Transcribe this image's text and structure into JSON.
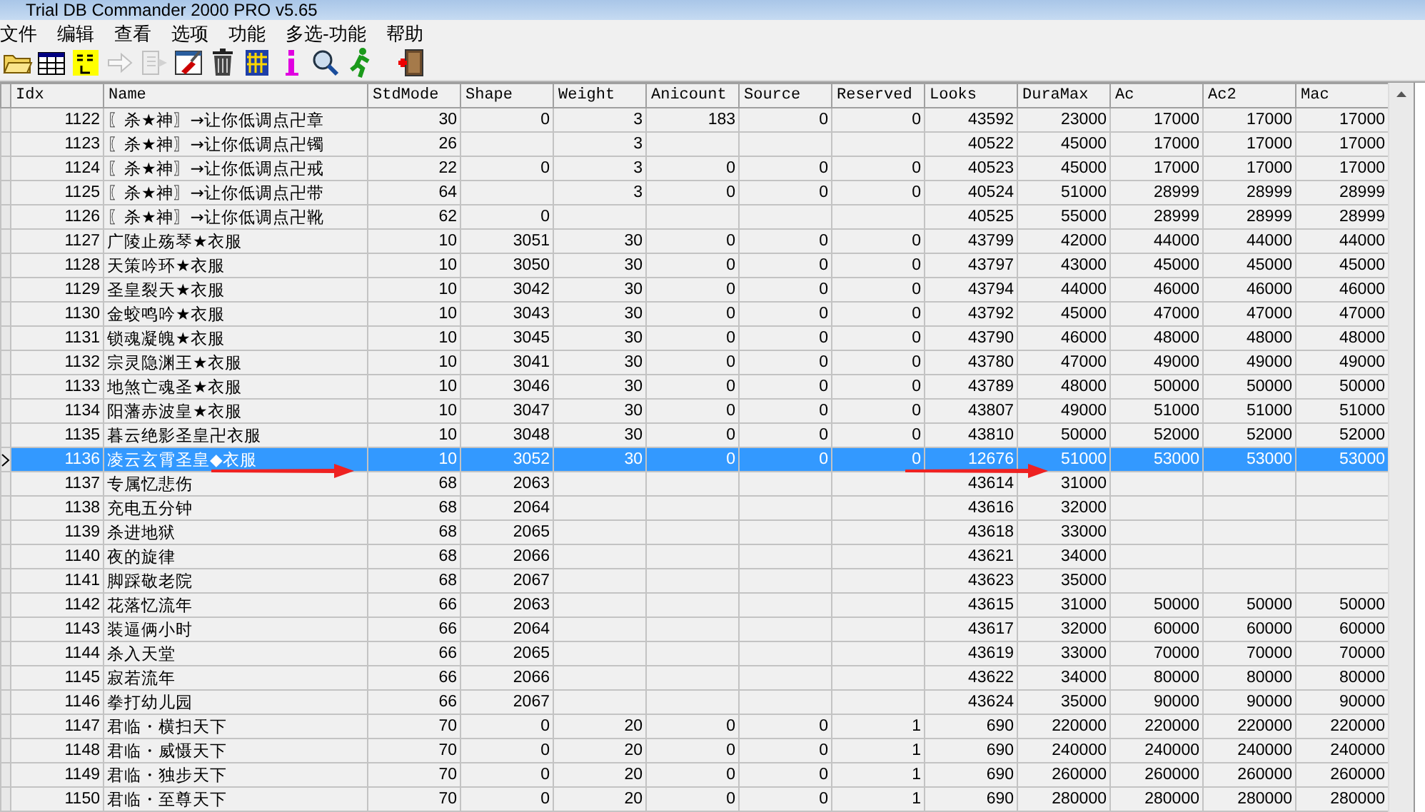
{
  "window": {
    "title": "Trial DB Commander 2000 PRO v5.65"
  },
  "menu": [
    "文件",
    "编辑",
    "查看",
    "选项",
    "功能",
    "多选-功能",
    "帮助"
  ],
  "toolbar": [
    {
      "kind": "folder",
      "disabled": false
    },
    {
      "kind": "table",
      "disabled": false
    },
    {
      "kind": "sql",
      "disabled": false
    },
    {
      "kind": "arrow",
      "disabled": true
    },
    {
      "kind": "doc-arrow",
      "disabled": true
    },
    {
      "kind": "brush",
      "disabled": false
    },
    {
      "kind": "trash",
      "disabled": false
    },
    {
      "kind": "grid",
      "disabled": false
    },
    {
      "kind": "info",
      "disabled": false
    },
    {
      "kind": "magnifier",
      "disabled": false
    },
    {
      "kind": "runner",
      "disabled": false
    },
    {
      "kind": "exit",
      "disabled": false
    }
  ],
  "table": {
    "columns": [
      "Idx",
      "Name",
      "StdMode",
      "Shape",
      "Weight",
      "Anicount",
      "Source",
      "Reserved",
      "Looks",
      "DuraMax",
      "Ac",
      "Ac2",
      "Mac"
    ],
    "rows": [
      {
        "selected": false,
        "cells": [
          "1122",
          "〖杀★神〗→让你低调点卍章",
          "30",
          "0",
          "3",
          "183",
          "0",
          "0",
          "43592",
          "23000",
          "17000",
          "17000",
          "17000"
        ]
      },
      {
        "selected": false,
        "cells": [
          "1123",
          "〖杀★神〗→让你低调点卍镯",
          "26",
          null,
          "3",
          null,
          null,
          null,
          "40522",
          "45000",
          "17000",
          "17000",
          "17000"
        ]
      },
      {
        "selected": false,
        "cells": [
          "1124",
          "〖杀★神〗→让你低调点卍戒",
          "22",
          "0",
          "3",
          "0",
          "0",
          "0",
          "40523",
          "45000",
          "17000",
          "17000",
          "17000"
        ]
      },
      {
        "selected": false,
        "cells": [
          "1125",
          "〖杀★神〗→让你低调点卍带",
          "64",
          null,
          "3",
          "0",
          "0",
          "0",
          "40524",
          "51000",
          "28999",
          "28999",
          "28999"
        ]
      },
      {
        "selected": false,
        "cells": [
          "1126",
          "〖杀★神〗→让你低调点卍靴",
          "62",
          "0",
          null,
          null,
          null,
          null,
          "40525",
          "55000",
          "28999",
          "28999",
          "28999"
        ]
      },
      {
        "selected": false,
        "cells": [
          "1127",
          "广陵止殇琴★衣服",
          "10",
          "3051",
          "30",
          "0",
          "0",
          "0",
          "43799",
          "42000",
          "44000",
          "44000",
          "44000"
        ]
      },
      {
        "selected": false,
        "cells": [
          "1128",
          "天策吟环★衣服",
          "10",
          "3050",
          "30",
          "0",
          "0",
          "0",
          "43797",
          "43000",
          "45000",
          "45000",
          "45000"
        ]
      },
      {
        "selected": false,
        "cells": [
          "1129",
          "圣皇裂天★衣服",
          "10",
          "3042",
          "30",
          "0",
          "0",
          "0",
          "43794",
          "44000",
          "46000",
          "46000",
          "46000"
        ]
      },
      {
        "selected": false,
        "cells": [
          "1130",
          "金蛟鸣吟★衣服",
          "10",
          "3043",
          "30",
          "0",
          "0",
          "0",
          "43792",
          "45000",
          "47000",
          "47000",
          "47000"
        ]
      },
      {
        "selected": false,
        "cells": [
          "1131",
          "锁魂凝魄★衣服",
          "10",
          "3045",
          "30",
          "0",
          "0",
          "0",
          "43790",
          "46000",
          "48000",
          "48000",
          "48000"
        ]
      },
      {
        "selected": false,
        "cells": [
          "1132",
          "宗灵隐渊王★衣服",
          "10",
          "3041",
          "30",
          "0",
          "0",
          "0",
          "43780",
          "47000",
          "49000",
          "49000",
          "49000"
        ]
      },
      {
        "selected": false,
        "cells": [
          "1133",
          "地煞亡魂圣★衣服",
          "10",
          "3046",
          "30",
          "0",
          "0",
          "0",
          "43789",
          "48000",
          "50000",
          "50000",
          "50000"
        ]
      },
      {
        "selected": false,
        "cells": [
          "1134",
          "阳藩赤波皇★衣服",
          "10",
          "3047",
          "30",
          "0",
          "0",
          "0",
          "43807",
          "49000",
          "51000",
          "51000",
          "51000"
        ]
      },
      {
        "selected": false,
        "cells": [
          "1135",
          "暮云绝影圣皇卍衣服",
          "10",
          "3048",
          "30",
          "0",
          "0",
          "0",
          "43810",
          "50000",
          "52000",
          "52000",
          "52000"
        ]
      },
      {
        "selected": true,
        "cells": [
          "1136",
          "凌云玄霄圣皇◆衣服",
          "10",
          "3052",
          "30",
          "0",
          "0",
          "0",
          "12676",
          "51000",
          "53000",
          "53000",
          "53000"
        ]
      },
      {
        "selected": false,
        "cells": [
          "1137",
          "专属忆悲伤",
          "68",
          "2063",
          null,
          null,
          null,
          null,
          "43614",
          "31000",
          null,
          null,
          null
        ]
      },
      {
        "selected": false,
        "cells": [
          "1138",
          "充电五分钟",
          "68",
          "2064",
          null,
          null,
          null,
          null,
          "43616",
          "32000",
          null,
          null,
          null
        ]
      },
      {
        "selected": false,
        "cells": [
          "1139",
          "杀进地狱",
          "68",
          "2065",
          null,
          null,
          null,
          null,
          "43618",
          "33000",
          null,
          null,
          null
        ]
      },
      {
        "selected": false,
        "cells": [
          "1140",
          "夜的旋律",
          "68",
          "2066",
          null,
          null,
          null,
          null,
          "43621",
          "34000",
          null,
          null,
          null
        ]
      },
      {
        "selected": false,
        "cells": [
          "1141",
          "脚踩敬老院",
          "68",
          "2067",
          null,
          null,
          null,
          null,
          "43623",
          "35000",
          null,
          null,
          null
        ]
      },
      {
        "selected": false,
        "cells": [
          "1142",
          "花落忆流年",
          "66",
          "2063",
          null,
          null,
          null,
          null,
          "43615",
          "31000",
          "50000",
          "50000",
          "50000"
        ]
      },
      {
        "selected": false,
        "cells": [
          "1143",
          "装逼俩小时",
          "66",
          "2064",
          null,
          null,
          null,
          null,
          "43617",
          "32000",
          "60000",
          "60000",
          "60000"
        ]
      },
      {
        "selected": false,
        "cells": [
          "1144",
          "杀入天堂",
          "66",
          "2065",
          null,
          null,
          null,
          null,
          "43619",
          "33000",
          "70000",
          "70000",
          "70000"
        ]
      },
      {
        "selected": false,
        "cells": [
          "1145",
          "寂若流年",
          "66",
          "2066",
          null,
          null,
          null,
          null,
          "43622",
          "34000",
          "80000",
          "80000",
          "80000"
        ]
      },
      {
        "selected": false,
        "cells": [
          "1146",
          "拳打幼儿园",
          "66",
          "2067",
          null,
          null,
          null,
          null,
          "43624",
          "35000",
          "90000",
          "90000",
          "90000"
        ]
      },
      {
        "selected": false,
        "cells": [
          "1147",
          "君临・横扫天下",
          "70",
          "0",
          "20",
          "0",
          "0",
          "1",
          "690",
          "220000",
          "220000",
          "220000",
          "220000"
        ]
      },
      {
        "selected": false,
        "cells": [
          "1148",
          "君临・威慑天下",
          "70",
          "0",
          "20",
          "0",
          "0",
          "1",
          "690",
          "240000",
          "240000",
          "240000",
          "240000"
        ]
      },
      {
        "selected": false,
        "cells": [
          "1149",
          "君临・独步天下",
          "70",
          "0",
          "20",
          "0",
          "0",
          "1",
          "690",
          "260000",
          "260000",
          "260000",
          "260000"
        ]
      },
      {
        "selected": false,
        "cells": [
          "1150",
          "君临・至尊天下",
          "70",
          "0",
          "20",
          "0",
          "0",
          "1",
          "690",
          "280000",
          "280000",
          "280000",
          "280000"
        ]
      }
    ]
  },
  "annotations": [
    {
      "kind": "arrow"
    },
    {
      "kind": "arrow"
    }
  ]
}
